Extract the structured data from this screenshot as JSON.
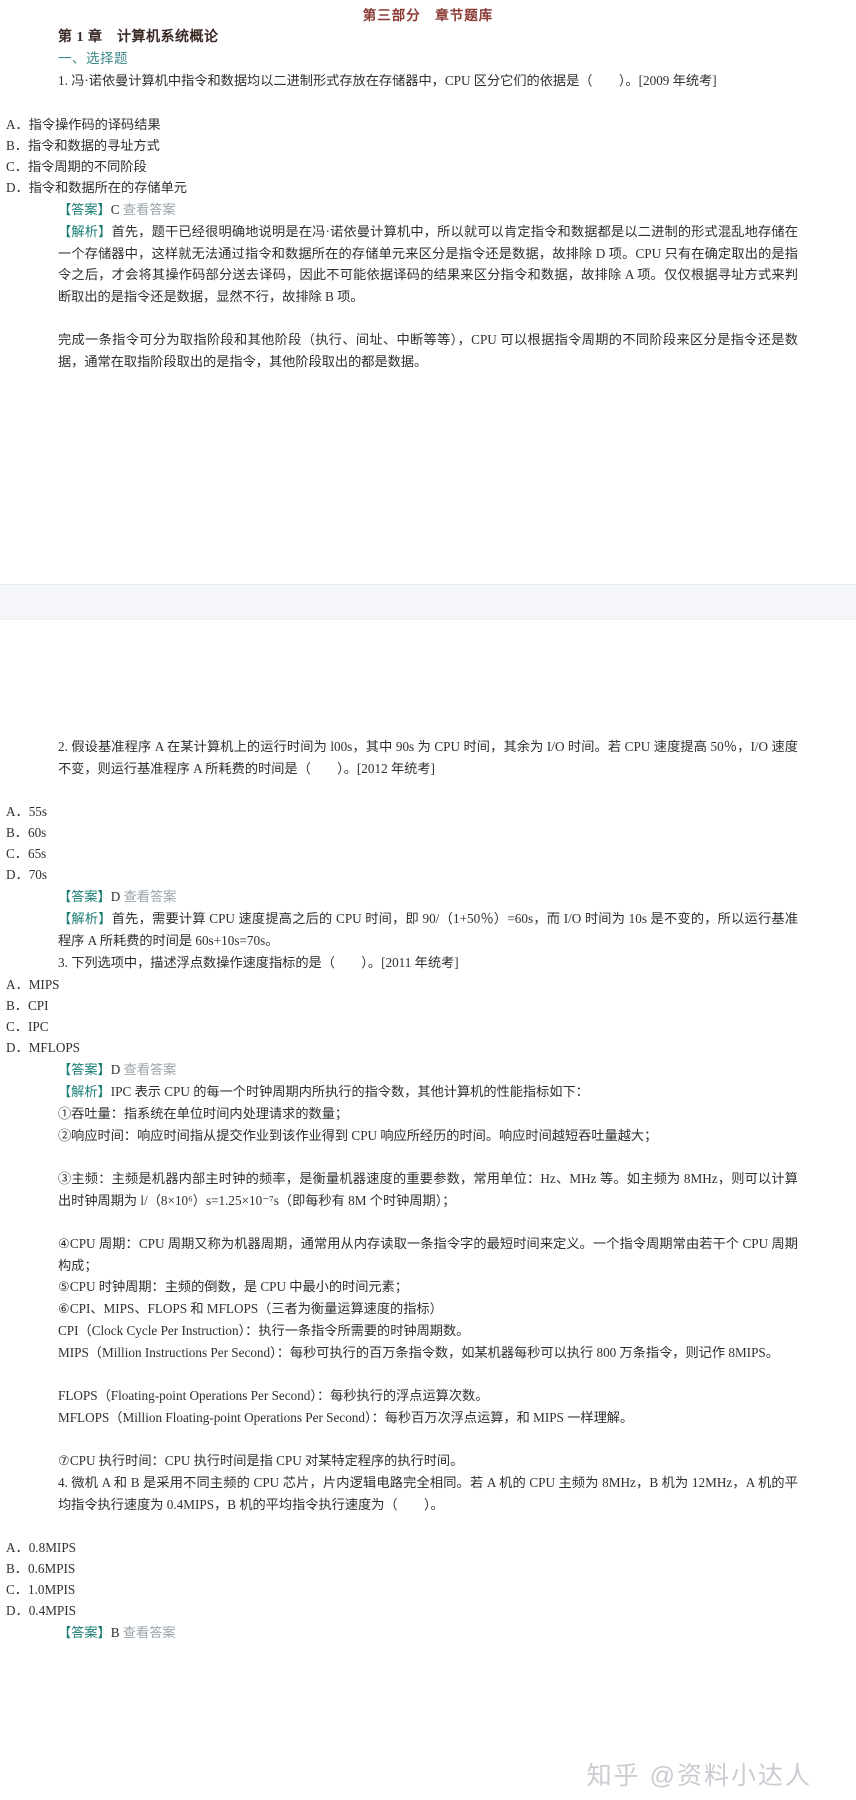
{
  "document": {
    "part_title": "第三部分　章节题库",
    "chapter_title": "第 1 章　计算机系统概论",
    "section_title": "一、选择题",
    "watermark": "知乎 @资料小达人",
    "reveal_label": "查看答案",
    "answer_tag": "【答案】",
    "analysis_tag": "【解析】",
    "colors": {
      "part_title": "#8a3a35",
      "chapter_title": "#3a2a26",
      "section_title": "#3d8a8a",
      "tag": "#1a7d74",
      "body": "#2f2f2f",
      "reveal_link": "#9aa6ad",
      "page_gap": "#f4f6f9",
      "watermark": "#c9ccd1"
    }
  },
  "questions": [
    {
      "number": "1.",
      "stem": "1. 冯·诺依曼计算机中指令和数据均以二进制形式存放在存储器中，CPU 区分它们的依据是（　　）。[2009 年统考]",
      "options": [
        "A．指令操作码的译码结果",
        "B．指令和数据的寻址方式",
        "C．指令周期的不同阶段",
        "D．指令和数据所在的存储单元"
      ],
      "answer": "C",
      "analysis_paragraphs": [
        "首先，题干已经很明确地说明是在冯·诺依曼计算机中，所以就可以肯定指令和数据都是以二进制的形式混乱地存储在一个存储器中，这样就无法通过指令和数据所在的存储单元来区分是指令还是数据，故排除 D 项。CPU 只有在确定取出的是指令之后，才会将其操作码部分送去译码，因此不可能依据译码的结果来区分指令和数据，故排除 A 项。仅仅根据寻址方式来判断取出的是指令还是数据，显然不行，故排除 B 项。",
        "完成一条指令可分为取指阶段和其他阶段（执行、间址、中断等等），CPU 可以根据指令周期的不同阶段来区分是指令还是数据，通常在取指阶段取出的是指令，其他阶段取出的都是数据。"
      ]
    },
    {
      "number": "2.",
      "stem": "2. 假设基准程序 A 在某计算机上的运行时间为 l00s，其中 90s 为 CPU 时间，其余为 I/O 时间。若 CPU 速度提高 50％，I/O 速度不变，则运行基准程序 A 所耗费的时间是（　　）。[2012 年统考]",
      "options": [
        "A．55s",
        "B．60s",
        "C．65s",
        "D．70s"
      ],
      "answer": "D",
      "analysis_paragraphs": [
        "首先，需要计算 CPU 速度提高之后的 CPU 时间，即 90/（1+50％）=60s，而 I/O 时间为 10s 是不变的，所以运行基准程序 A 所耗费的时间是 60s+10s=70s。"
      ]
    },
    {
      "number": "3.",
      "stem": "3. 下列选项中，描述浮点数操作速度指标的是（　　）。[2011 年统考]",
      "options": [
        "A．MIPS",
        "B．CPI",
        "C．IPC",
        "D．MFLOPS"
      ],
      "answer": "D",
      "analysis_paragraphs": [
        "IPC 表示 CPU 的每一个时钟周期内所执行的指令数，其他计算机的性能指标如下：",
        "①吞吐量：指系统在单位时间内处理请求的数量；",
        "②响应时间：响应时间指从提交作业到该作业得到 CPU 响应所经历的时间。响应时间越短吞吐量越大；",
        "③主频：主频是机器内部主时钟的频率，是衡量机器速度的重要参数，常用单位：Hz、MHz 等。如主频为 8MHz，则可以计算出时钟周期为 l/（8×10⁶）s=1.25×10⁻⁷s（即每秒有 8M 个时钟周期）；",
        "④CPU 周期：CPU 周期又称为机器周期，通常用从内存读取一条指令字的最短时间来定义。一个指令周期常由若干个 CPU 周期构成；",
        "⑤CPU 时钟周期：主频的倒数，是 CPU 中最小的时间元素；",
        "⑥CPI、MIPS、FLOPS 和 MFLOPS（三者为衡量运算速度的指标）",
        "CPI（Clock Cycle Per Instruction）：执行一条指令所需要的时钟周期数。",
        "MIPS（Million Instructions Per Second）：每秒可执行的百万条指令数，如某机器每秒可以执行 800 万条指令，则记作 8MIPS。",
        "FLOPS（Floating-point Operations Per Second）：每秒执行的浮点运算次数。",
        "MFLOPS（Million Floating-point Operations Per Second）：每秒百万次浮点运算，和 MIPS 一样理解。",
        "⑦CPU 执行时间：CPU 执行时间是指 CPU 对某特定程序的执行时间。"
      ]
    },
    {
      "number": "4.",
      "stem": "4. 微机 A 和 B 是采用不同主频的 CPU 芯片，片内逻辑电路完全相同。若 A 机的 CPU 主频为 8MHz，B 机为 12MHz，A 机的平均指令执行速度为 0.4MIPS，B 机的平均指令执行速度为（　　）。",
      "options": [
        "A．0.8MIPS",
        "B．0.6MPIS",
        "C．1.0MPIS",
        "D．0.4MPIS"
      ],
      "answer": "B",
      "analysis_paragraphs": []
    }
  ]
}
